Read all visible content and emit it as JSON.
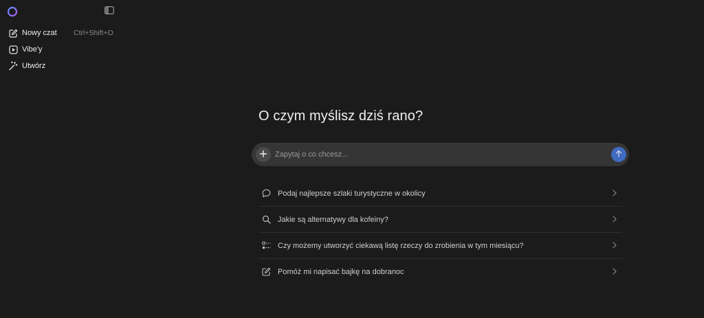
{
  "sidebar": {
    "logo_icon": "assistant-ring-logo",
    "collapse_icon": "sidebar-toggle-icon",
    "items": [
      {
        "label": "Nowy czat",
        "icon": "new-chat-icon",
        "shortcut": "Ctrl+Shift+O"
      },
      {
        "label": "Vibe'y",
        "icon": "play-square-icon",
        "shortcut": ""
      },
      {
        "label": "Utwórz",
        "icon": "magic-wand-icon",
        "shortcut": ""
      }
    ]
  },
  "main": {
    "heading": "O czym myślisz dziś rano?",
    "composer": {
      "placeholder": "Zapytaj o co chcesz...",
      "value": "",
      "plus_icon": "plus-icon",
      "send_icon": "arrow-up-icon"
    },
    "suggestions": [
      {
        "label": "Podaj najlepsze szlaki turystyczne w okolicy",
        "icon": "speech-bubble-icon"
      },
      {
        "label": "Jakie są alternatywy dla kofeiny?",
        "icon": "search-icon"
      },
      {
        "label": "Czy możemy utworzyć ciekawą listę rzeczy do zrobienia w tym miesiącu?",
        "icon": "checklist-icon"
      },
      {
        "label": "Pomóż mi napisać bajkę na dobranoc",
        "icon": "edit-icon"
      }
    ]
  },
  "colors": {
    "background": "#1b1b1b",
    "composer_bg": "#353535",
    "send_button": "#3f6bc0",
    "logo_gradient_start": "#5b8cff",
    "logo_gradient_end": "#b45cff"
  }
}
